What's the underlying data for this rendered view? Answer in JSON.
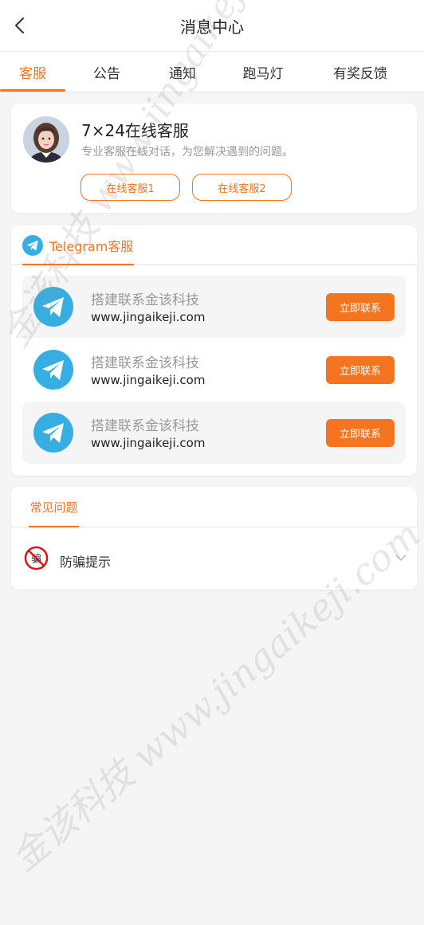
{
  "header": {
    "title": "消息中心"
  },
  "tabs": [
    {
      "label": "客服",
      "active": true
    },
    {
      "label": "公告",
      "active": false
    },
    {
      "label": "通知",
      "active": false
    },
    {
      "label": "跑马灯",
      "active": false
    },
    {
      "label": "有奖反馈",
      "active": false
    }
  ],
  "service": {
    "title": "7×24在线客服",
    "description": "专业客服在线对话，为您解决遇到的问题。",
    "button1": "在线客服1",
    "button2": "在线客服2"
  },
  "telegram": {
    "tab_label": "Telegram客服",
    "items": [
      {
        "name": "搭建联系金该科技",
        "url": "www.jingaikeji.com",
        "button": "立即联系"
      },
      {
        "name": "搭建联系金该科技",
        "url": "www.jingaikeji.com",
        "button": "立即联系"
      },
      {
        "name": "搭建联系金该科技",
        "url": "www.jingaikeji.com",
        "button": "立即联系"
      }
    ]
  },
  "faq": {
    "tab_label": "常见问题",
    "items": [
      {
        "label": "防骗提示",
        "icon": "anti-fraud-icon"
      }
    ]
  },
  "watermark": {
    "text": "金该科技 www.jingaikeji.com"
  },
  "colors": {
    "accent": "#f57420",
    "telegram_blue": "#37aee2",
    "background": "#f5f5f5"
  }
}
